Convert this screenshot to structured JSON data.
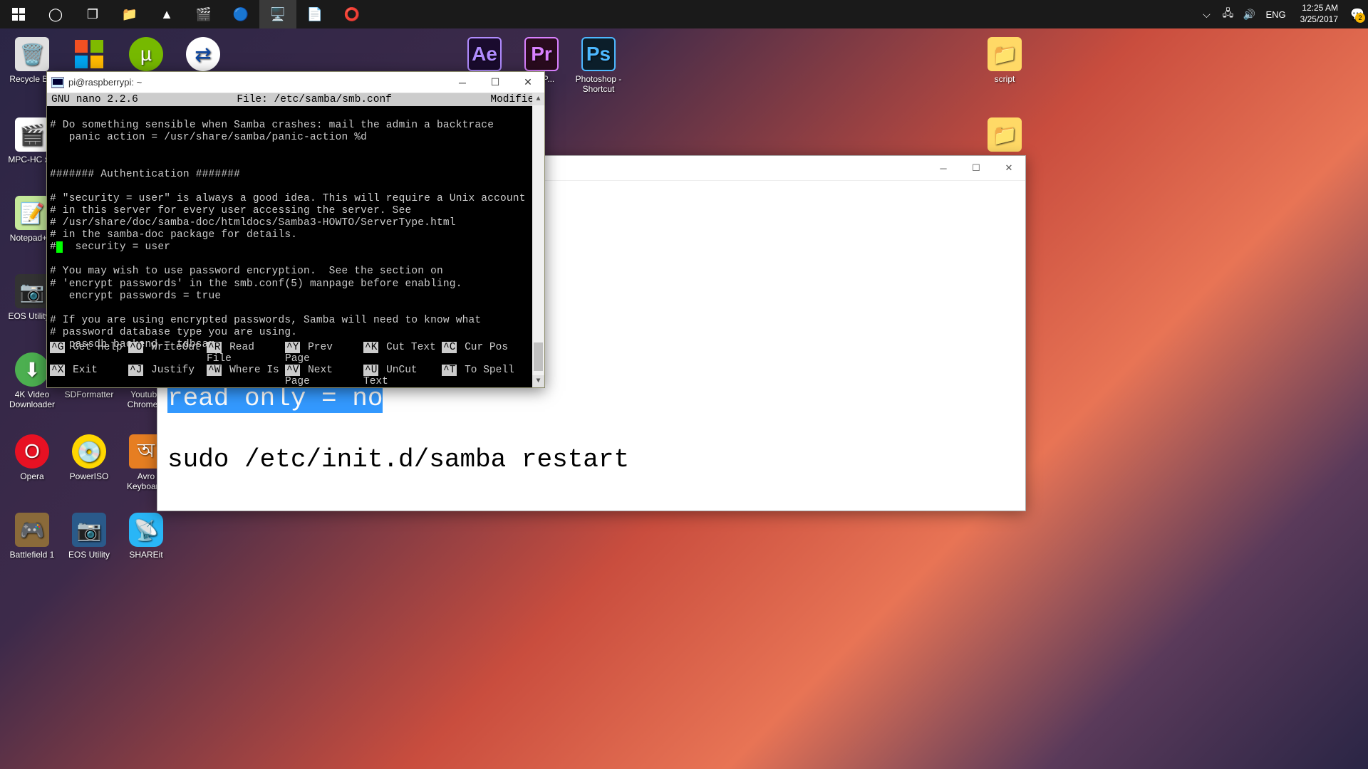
{
  "taskbar": {
    "lang": "ENG",
    "time": "12:25 AM",
    "date": "3/25/2017",
    "notif_count": "2"
  },
  "desktop": {
    "recycle": "Recycle Bin",
    "mpc": "MPC-HC x...",
    "notepadpp": "Notepad+...",
    "eosutility1": "EOS Utility...",
    "4kvideo": "4K Video Downloader",
    "opera": "Opera",
    "bf1": "Battlefield 1",
    "sdformatter": "SDFormatter",
    "poweriso": "PowerISO",
    "eosutility2": "EOS Utility",
    "youchrome": "Youtube Chrome...",
    "avro": "Avro Keyboar...",
    "shareit": "SHAREit",
    "ae": "...e",
    "pr": "...e P...",
    "ps": "Photoshop - Shortcut",
    "script": "script"
  },
  "putty": {
    "title": "pi@raspberrypi: ~",
    "nano": {
      "ver": "  GNU nano 2.2.6",
      "file": "File: /etc/samba/smb.conf",
      "status": "Modified  "
    },
    "content": [
      "",
      "# Do something sensible when Samba crashes: mail the admin a backtrace",
      "   panic action = /usr/share/samba/panic-action %d",
      "",
      "",
      "####### Authentication #######",
      "",
      "# \"security = user\" is always a good idea. This will require a Unix account",
      "# in this server for every user accessing the server. See",
      "# /usr/share/doc/samba-doc/htmldocs/Samba3-HOWTO/ServerType.html",
      "# in the samba-doc package for details.",
      "#   security = user",
      "",
      "# You may wish to use password encryption.  See the section on",
      "# 'encrypt passwords' in the smb.conf(5) manpage before enabling.",
      "   encrypt passwords = true",
      "",
      "# If you are using encrypted passwords, Samba will need to know what",
      "# password database type you are using.",
      "   passdb backend = tdbsam"
    ],
    "cursor_line": 11,
    "cursor_col": 1,
    "footer": [
      [
        {
          "k": "^G",
          "l": "Get Help"
        },
        {
          "k": "^O",
          "l": "WriteOut"
        },
        {
          "k": "^R",
          "l": "Read File"
        },
        {
          "k": "^Y",
          "l": "Prev Page"
        },
        {
          "k": "^K",
          "l": "Cut Text"
        },
        {
          "k": "^C",
          "l": "Cur Pos"
        }
      ],
      [
        {
          "k": "^X",
          "l": "Exit"
        },
        {
          "k": "^J",
          "l": "Justify"
        },
        {
          "k": "^W",
          "l": "Where Is"
        },
        {
          "k": "^V",
          "l": "Next Page"
        },
        {
          "k": "^U",
          "l": "UnCut Text"
        },
        {
          "k": "^T",
          "l": "To Spell"
        }
      ]
    ]
  },
  "notepad": {
    "highlighted": "read only = no",
    "line2": "sudo /etc/init.d/samba restart"
  }
}
